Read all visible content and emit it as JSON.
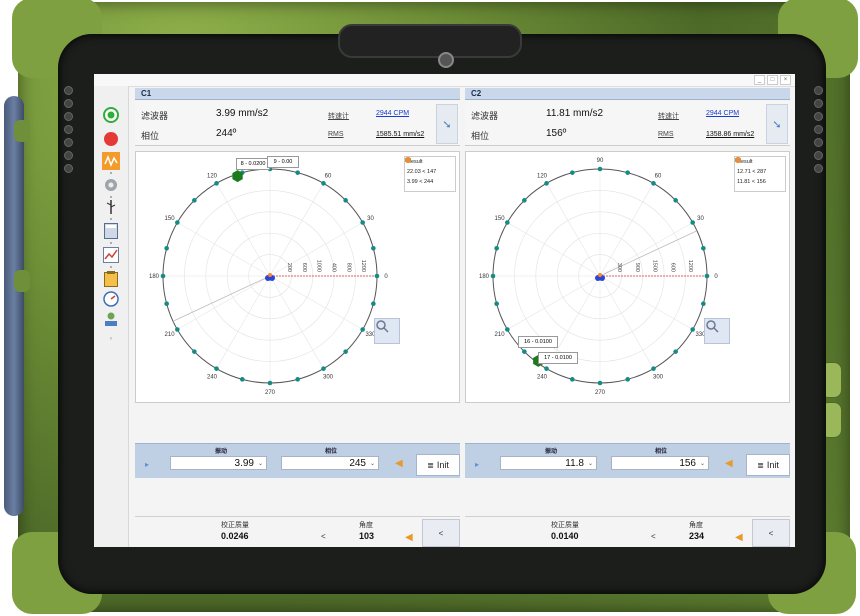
{
  "window": {
    "controls": [
      "_",
      "□",
      "×"
    ]
  },
  "toolbar": {
    "icons": [
      "start-icon",
      "stop-icon",
      "wave-icon",
      "gear-icon",
      "usb-icon",
      "calculator-icon",
      "trend-icon",
      "clipboard-icon",
      "gauge-icon",
      "user-icon"
    ]
  },
  "panels": [
    {
      "title": "C1",
      "filter_label": "滤波器",
      "filter_value": "3.99 mm/s2",
      "speed_label": "转速计",
      "speed_value": "2944 CPM",
      "phase_label": "相位",
      "phase_value": "244º",
      "rms_label": "RMS",
      "rms_value": "1585.51 mm/s2",
      "angle_labels": [
        "90",
        "60",
        "30",
        "0",
        "330",
        "300",
        "270",
        "240",
        "210",
        "180",
        "150",
        "120"
      ],
      "radial_labels": [
        "400",
        "800",
        "1200"
      ],
      "small_radial_labels": [
        "200",
        "600",
        "1000"
      ],
      "tooltips": [
        "8 - 0.0200",
        "9 - 0.00"
      ],
      "legend": [
        {
          "name": "Result",
          "color": "#1e7a1e"
        },
        {
          "name": "22.03 < 147",
          "color": "#3fa7c9"
        },
        {
          "name": "3.99 < 244",
          "color": "#f08a33"
        }
      ],
      "vib_label": "振动",
      "phase_hdr_label": "相位",
      "vib_input": "3.99",
      "phase_input": "245",
      "init_label": "Init",
      "mass_label": "校正质量",
      "mass_value": "0.0246",
      "angle_label": "角度",
      "angle_value": "103",
      "lt_symbol": "<",
      "back_symbol": "<"
    },
    {
      "title": "C2",
      "filter_label": "滤波器",
      "filter_value": "11.81 mm/s2",
      "speed_label": "转速计",
      "speed_value": "2944 CPM",
      "phase_label": "相位",
      "phase_value": "156º",
      "rms_label": "RMS",
      "rms_value": "1358.86 mm/s2",
      "angle_labels": [
        "90",
        "60",
        "30",
        "0",
        "330",
        "300",
        "270",
        "240",
        "210",
        "180",
        "150",
        "120"
      ],
      "radial_labels": [
        "600",
        "1200"
      ],
      "small_radial_labels": [
        "300",
        "900",
        "1500"
      ],
      "tooltips": [
        "16 - 0.0100",
        "17 - 0.0100"
      ],
      "legend": [
        {
          "name": "Result",
          "color": "#1e7a1e"
        },
        {
          "name": "12.71 < 287",
          "color": "#3fa7c9"
        },
        {
          "name": "11.81 < 156",
          "color": "#f08a33"
        }
      ],
      "vib_label": "振动",
      "phase_hdr_label": "相位",
      "vib_input": "11.8",
      "phase_input": "156",
      "init_label": "Init",
      "mass_label": "校正质量",
      "mass_value": "0.0140",
      "angle_label": "角度",
      "angle_value": "234",
      "lt_symbol": "<",
      "back_symbol": "<"
    }
  ]
}
